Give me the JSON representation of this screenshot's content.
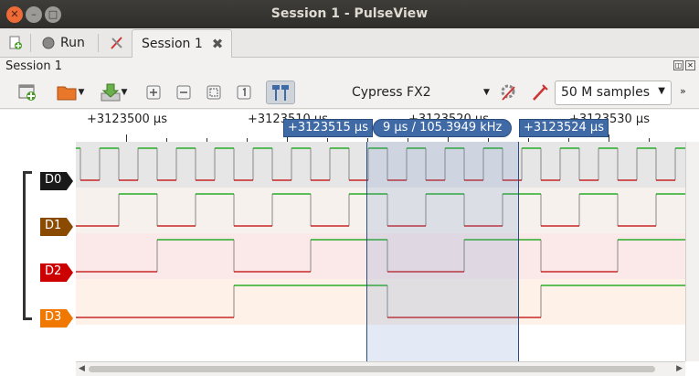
{
  "window": {
    "title": "Session 1 - PulseView"
  },
  "tabbar": {
    "run_label": "Run",
    "tab_label": "Session 1",
    "tab_close": "✖"
  },
  "dock": {
    "title": "Session 1"
  },
  "toolbar": {
    "device": "Cypress FX2",
    "samples": "50 M samples"
  },
  "ruler": {
    "labels": [
      "+3123500 µs",
      "+3123510 µs",
      "+3123520 µs",
      "+3123530 µs"
    ],
    "cursor1": "+3123515 µs",
    "cursor_delta": "9 µs / 105.3949 kHz",
    "cursor2": "+3123524 µs"
  },
  "channels": [
    {
      "name": "D0",
      "color": "#1a1a1a",
      "half_period_us": 1
    },
    {
      "name": "D1",
      "color": "#8a4a00",
      "half_period_us": 2
    },
    {
      "name": "D2",
      "color": "#cc0000",
      "half_period_us": 4
    },
    {
      "name": "D3",
      "color": "#f07800",
      "half_period_us": 8
    }
  ],
  "colors": {
    "high": "#00a000",
    "low": "#c00000",
    "cursor": "#3f6aa5"
  }
}
